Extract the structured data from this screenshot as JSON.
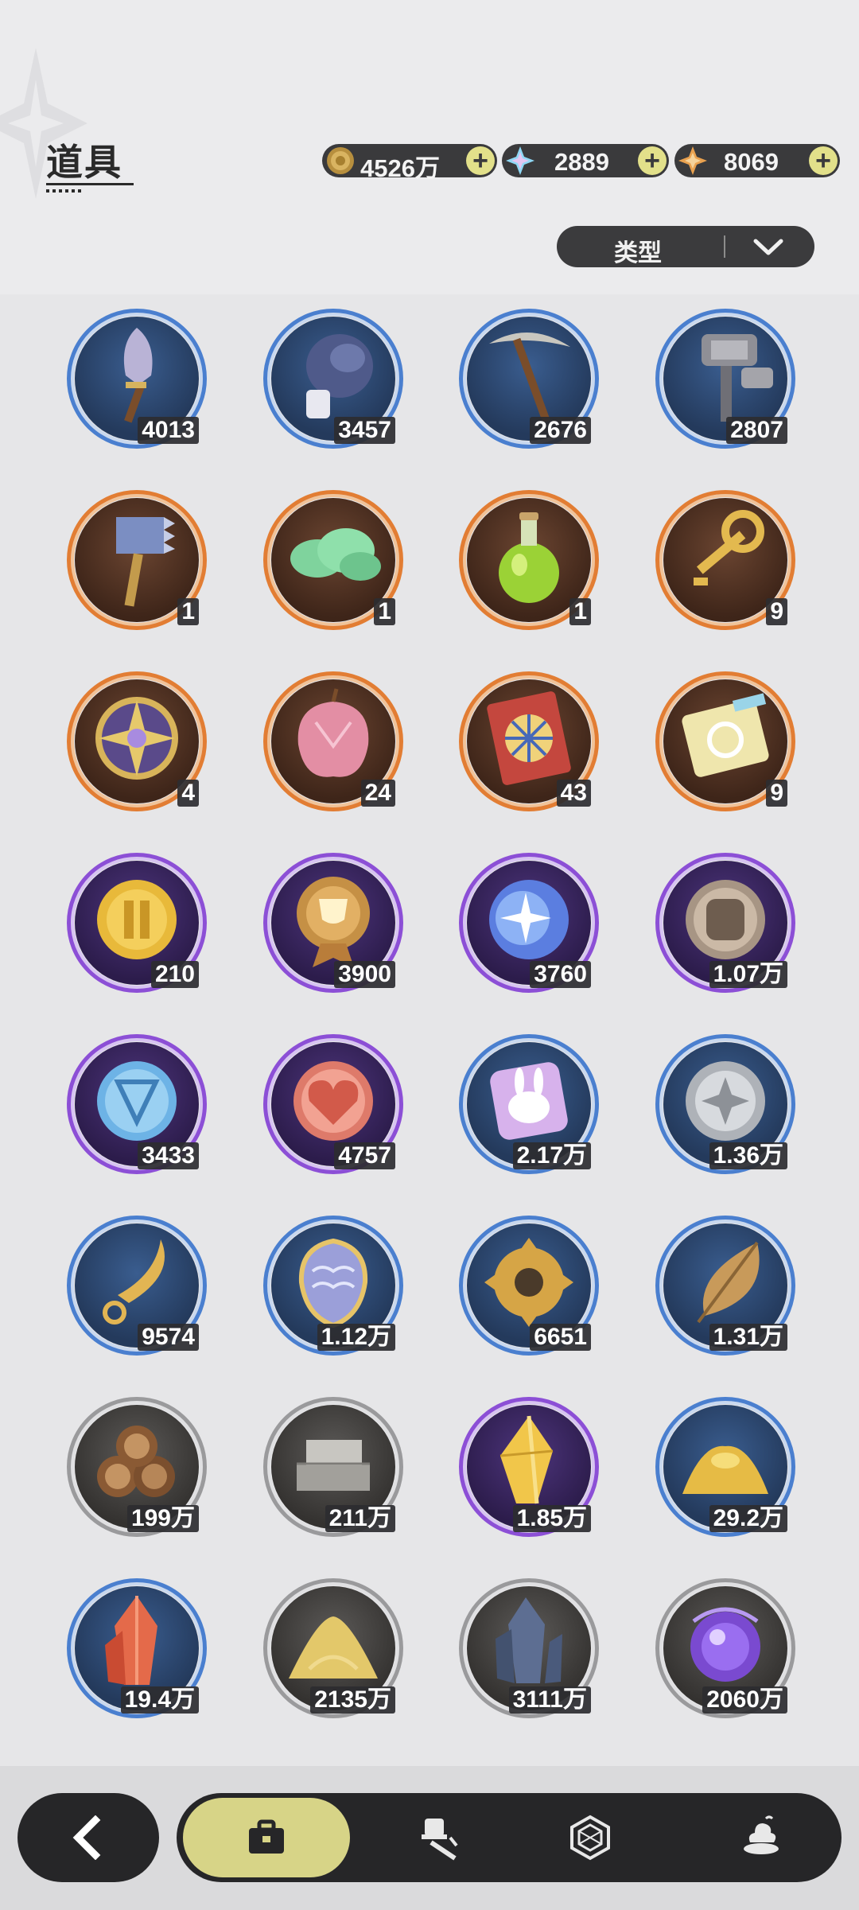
{
  "header": {
    "title": "道具",
    "currencies": [
      {
        "icon": "mora-coin-icon",
        "value": "4526万"
      },
      {
        "icon": "primogem-icon",
        "value": "2889"
      },
      {
        "icon": "starglitter-icon",
        "value": "8069"
      }
    ],
    "filter": {
      "label": "类型",
      "icon": "chevron-down-icon"
    }
  },
  "items": [
    {
      "icon": "shovel-icon",
      "rarity": "blue",
      "qty": "4013"
    },
    {
      "icon": "boxing-glove-icon",
      "rarity": "blue",
      "qty": "3457"
    },
    {
      "icon": "pickaxe-icon",
      "rarity": "blue",
      "qty": "2676"
    },
    {
      "icon": "hammer-icon",
      "rarity": "blue",
      "qty": "2807"
    },
    {
      "icon": "spiked-hammer-icon",
      "rarity": "orange",
      "qty": "1"
    },
    {
      "icon": "green-cloud-icon",
      "rarity": "orange",
      "qty": "1"
    },
    {
      "icon": "potion-bottle-icon",
      "rarity": "orange",
      "qty": "1"
    },
    {
      "icon": "golden-key-icon",
      "rarity": "orange",
      "qty": "9"
    },
    {
      "icon": "compass-emblem-icon",
      "rarity": "orange",
      "qty": "4"
    },
    {
      "icon": "crystal-apple-icon",
      "rarity": "orange",
      "qty": "24"
    },
    {
      "icon": "wheel-ticket-icon",
      "rarity": "orange",
      "qty": "43"
    },
    {
      "icon": "puzzle-ticket-icon",
      "rarity": "orange",
      "qty": "9"
    },
    {
      "icon": "gold-coin-icon",
      "rarity": "purple",
      "qty": "210"
    },
    {
      "icon": "trophy-medal-icon",
      "rarity": "purple",
      "qty": "3900"
    },
    {
      "icon": "star-moon-coin-icon",
      "rarity": "purple",
      "qty": "3760"
    },
    {
      "icon": "fist-coin-icon",
      "rarity": "purple",
      "qty": "1.07万"
    },
    {
      "icon": "blue-rune-coin-icon",
      "rarity": "purple",
      "qty": "3433"
    },
    {
      "icon": "heart-coin-icon",
      "rarity": "purple",
      "qty": "4757"
    },
    {
      "icon": "rabbit-card-icon",
      "rarity": "blue",
      "qty": "2.17万"
    },
    {
      "icon": "silver-coin-icon",
      "rarity": "blue",
      "qty": "1.36万"
    },
    {
      "icon": "golden-blade-icon",
      "rarity": "blue",
      "qty": "9574"
    },
    {
      "icon": "scale-shield-icon",
      "rarity": "blue",
      "qty": "1.12万"
    },
    {
      "icon": "gear-icon",
      "rarity": "blue",
      "qty": "6651"
    },
    {
      "icon": "golden-leaf-icon",
      "rarity": "blue",
      "qty": "1.31万"
    },
    {
      "icon": "wood-logs-icon",
      "rarity": "gray",
      "qty": "199万"
    },
    {
      "icon": "stone-bricks-icon",
      "rarity": "gray",
      "qty": "211万"
    },
    {
      "icon": "gold-crystal-icon",
      "rarity": "purple",
      "qty": "1.85万"
    },
    {
      "icon": "gold-dust-icon",
      "rarity": "blue",
      "qty": "29.2万"
    },
    {
      "icon": "red-crystal-icon",
      "rarity": "blue",
      "qty": "19.4万"
    },
    {
      "icon": "sand-pile-icon",
      "rarity": "gray",
      "qty": "2135万"
    },
    {
      "icon": "dark-crystal-icon",
      "rarity": "gray",
      "qty": "3111万"
    },
    {
      "icon": "purple-orb-icon",
      "rarity": "gray",
      "qty": "2060万"
    }
  ],
  "bottom_nav": {
    "back_icon": "back-arrow-icon",
    "tabs": [
      {
        "icon": "briefcase-icon",
        "active": true
      },
      {
        "icon": "hat-fork-icon",
        "active": false
      },
      {
        "icon": "hexagon-icon",
        "active": false
      },
      {
        "icon": "dessert-icon",
        "active": false
      }
    ]
  }
}
